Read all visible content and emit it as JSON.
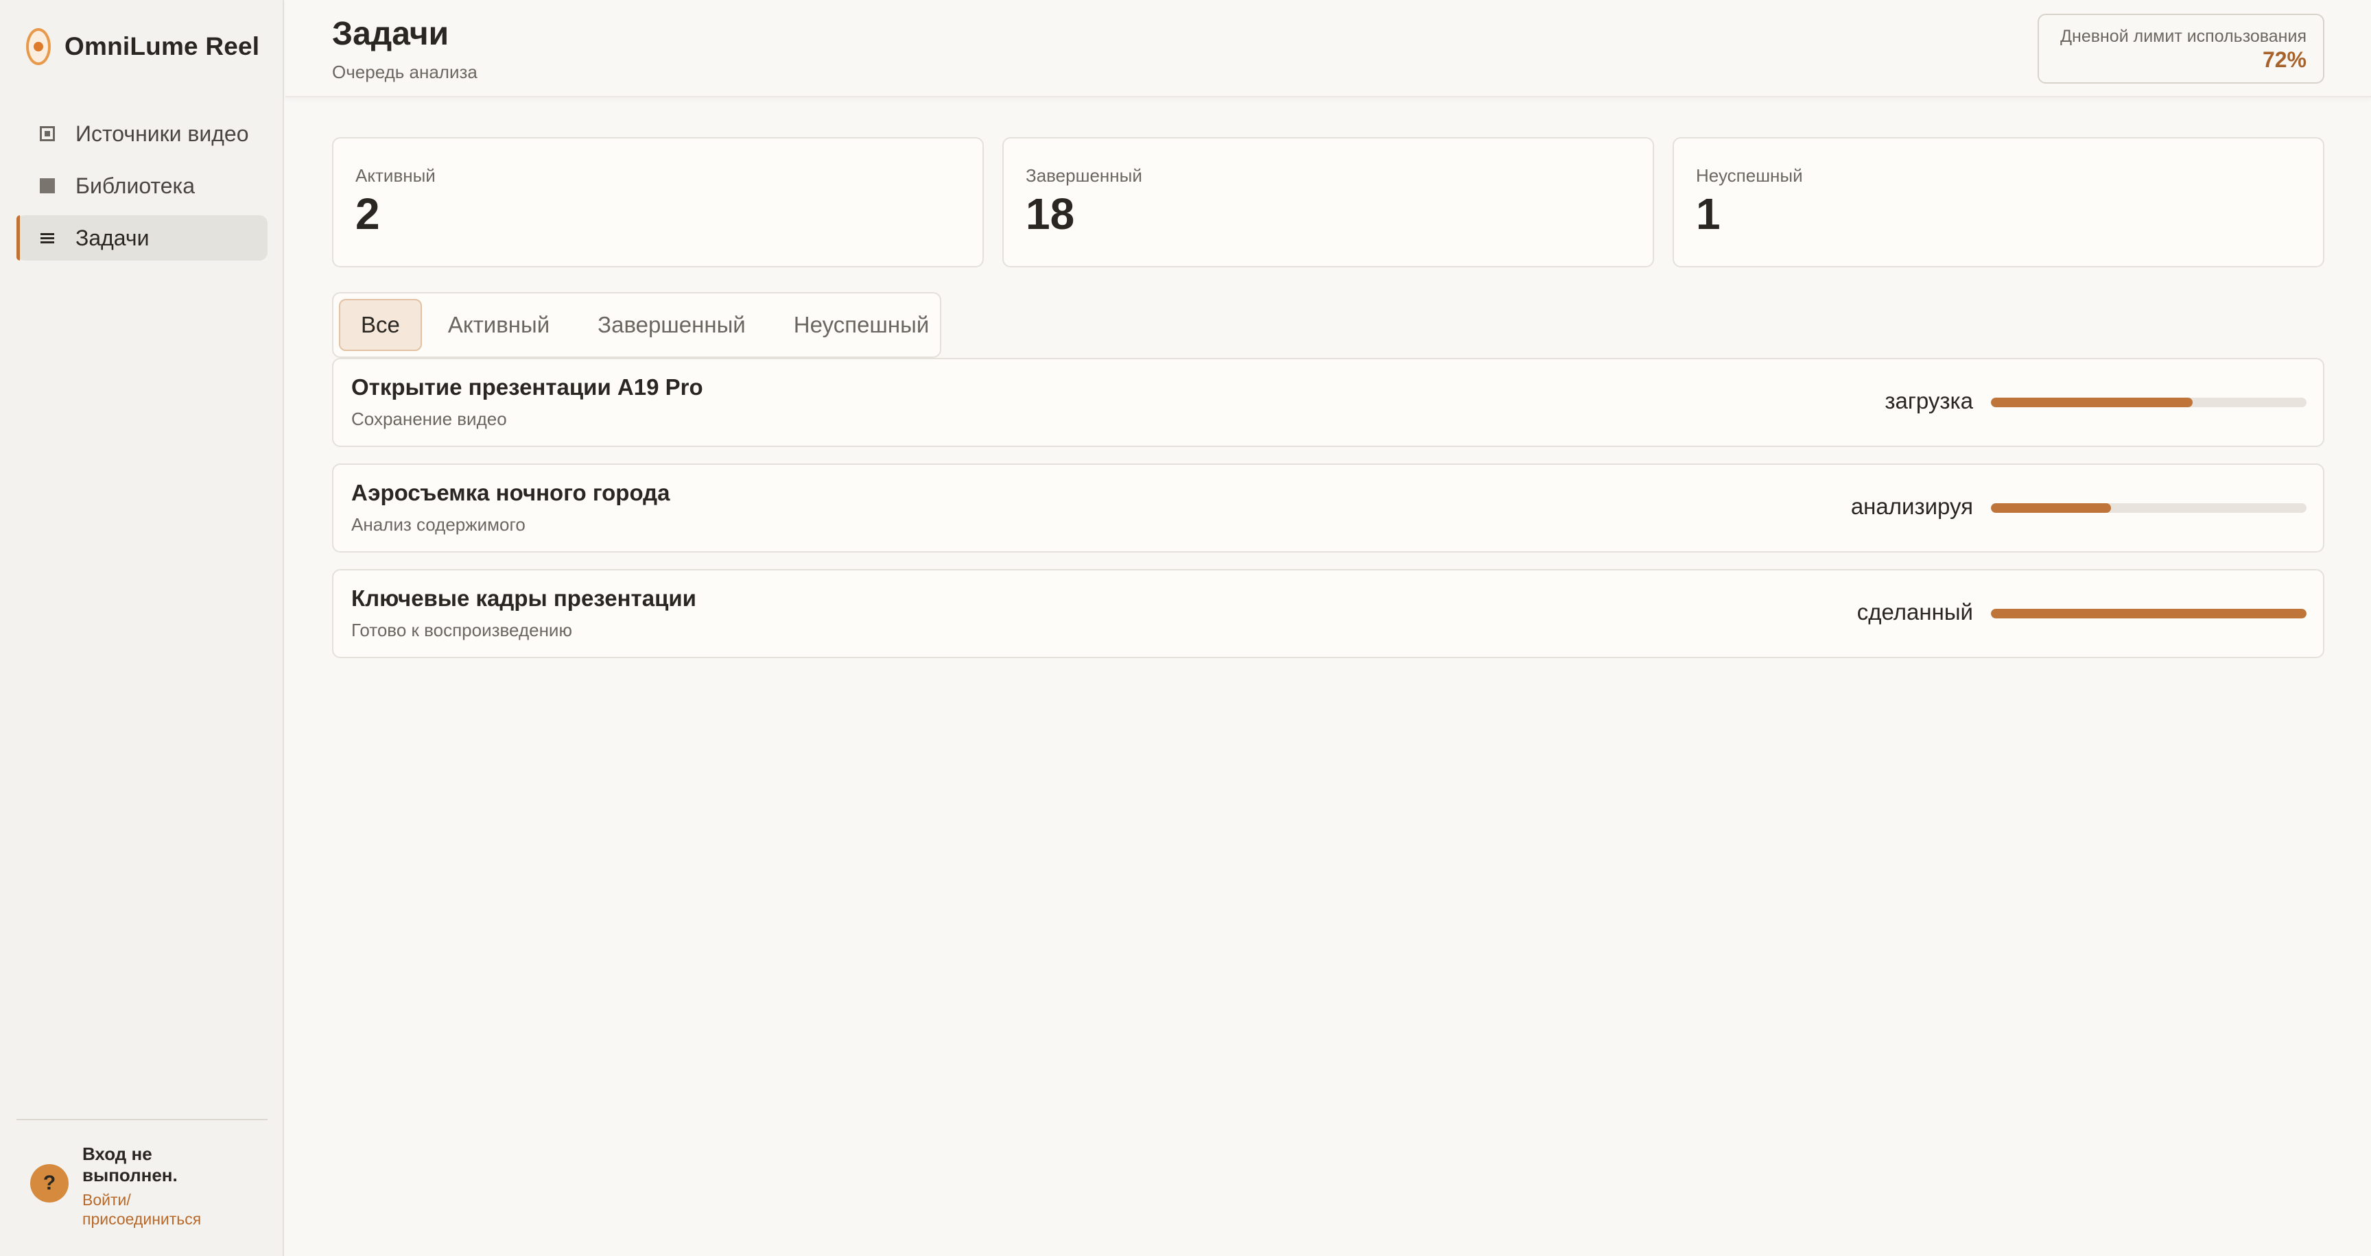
{
  "app": {
    "name": "OmniLume Reel",
    "logo_icon": "lens-icon",
    "accent_color": "#bf7439"
  },
  "sidebar": {
    "items": [
      {
        "label": "Источники видео",
        "icon": "source-icon",
        "active": false
      },
      {
        "label": "Библиотека",
        "icon": "library-icon",
        "active": false
      },
      {
        "label": "Задачи",
        "icon": "list-icon",
        "active": true
      }
    ]
  },
  "account": {
    "avatar_glyph": "?",
    "status": "Вход не выполнен.",
    "link": "Войти/присоединиться"
  },
  "header": {
    "title": "Задачи",
    "subtitle": "Очередь анализа",
    "quota_label": "Дневной лимит использования",
    "quota_value": "72%"
  },
  "stats": [
    {
      "label": "Активный",
      "value": "2"
    },
    {
      "label": "Завершенный",
      "value": "18"
    },
    {
      "label": "Неуспешный",
      "value": "1"
    }
  ],
  "tabs": [
    {
      "label": "Все",
      "active": true
    },
    {
      "label": "Активный",
      "active": false
    },
    {
      "label": "Завершенный",
      "active": false
    },
    {
      "label": "Неуспешный",
      "active": false
    }
  ],
  "tasks": [
    {
      "title": "Открытие презентации A19 Pro",
      "subtitle": "Сохранение видео",
      "status": "загрузка",
      "progress": 0.64
    },
    {
      "title": "Аэросъемка ночного города",
      "subtitle": "Анализ содержимого",
      "status": "анализируя",
      "progress": 0.38
    },
    {
      "title": "Ключевые кадры презентации",
      "subtitle": "Готово к воспроизведению",
      "status": "сделанный",
      "progress": 1.0
    }
  ]
}
